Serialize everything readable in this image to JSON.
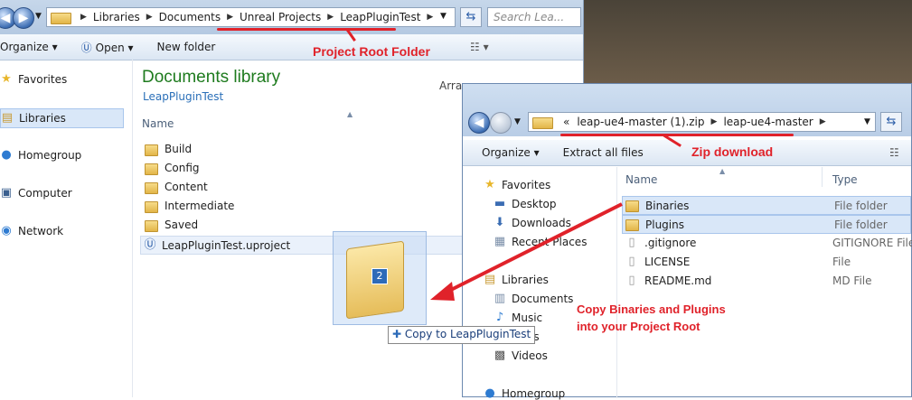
{
  "window1": {
    "address_parts": [
      "Libraries",
      "Documents",
      "Unreal Projects",
      "LeapPluginTest"
    ],
    "search_placeholder": "Search Lea...",
    "toolbar": {
      "organize": "Organize",
      "open": "Open",
      "new_folder": "New folder"
    },
    "nav": [
      "Favorites",
      "Libraries",
      "Homegroup",
      "Computer",
      "Network"
    ],
    "library_title": "Documents library",
    "library_subtitle": "LeapPluginTest",
    "arrange_label": "Arra",
    "column_name": "Name",
    "files": [
      "Build",
      "Config",
      "Content",
      "Intermediate",
      "Saved",
      "LeapPluginTest.uproject"
    ]
  },
  "window2": {
    "address_prefix": "«",
    "address_parts": [
      "leap-ue4-master (1).zip",
      "leap-ue4-master"
    ],
    "toolbar": {
      "organize": "Organize",
      "extract": "Extract all files"
    },
    "nav": [
      "Favorites",
      "Desktop",
      "Downloads",
      "Recent Places",
      "Libraries",
      "Documents",
      "Music",
      "tures",
      "Videos",
      "Homegroup"
    ],
    "columns": {
      "name": "Name",
      "type": "Type"
    },
    "files": [
      {
        "name": "Binaries",
        "type": "File folder"
      },
      {
        "name": "Plugins",
        "type": "File folder"
      },
      {
        "name": ".gitignore",
        "type": "GITIGNORE File"
      },
      {
        "name": "LICENSE",
        "type": "File"
      },
      {
        "name": "README.md",
        "type": "MD File"
      }
    ]
  },
  "drag": {
    "count": "2",
    "tooltip": "Copy to LeapPluginTest"
  },
  "annotations": {
    "project_root": "Project Root Folder",
    "zip_download": "Zip download",
    "copy_line1": "Copy Binaries and Plugins",
    "copy_line2": "into your Project Root"
  },
  "colors": {
    "annotation_red": "#e0222a",
    "library_title_green": "#1e7b1e"
  }
}
